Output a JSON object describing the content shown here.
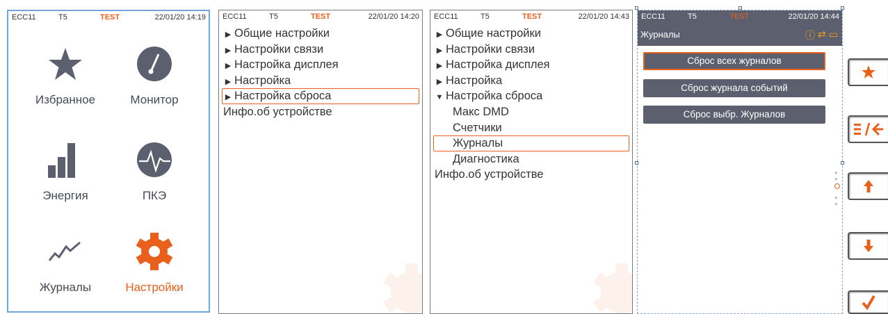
{
  "status": {
    "device": "ECC11",
    "tariff": "T5",
    "mode": "TEST"
  },
  "screen1": {
    "time": "22/01/20 14:19",
    "tiles": [
      {
        "label": "Избранное",
        "icon": "star-icon"
      },
      {
        "label": "Монитор",
        "icon": "gauge-icon"
      },
      {
        "label": "Энергия",
        "icon": "bar-chart-icon"
      },
      {
        "label": "ПКЭ",
        "icon": "waveform-icon"
      },
      {
        "label": "Журналы",
        "icon": "trend-line-icon"
      },
      {
        "label": "Настройки",
        "icon": "settings-gear-icon",
        "active": true
      }
    ]
  },
  "screen2": {
    "time": "22/01/20 14:20",
    "items": [
      "Общие настройки",
      "Настройки связи",
      "Настройка дисплея",
      "Настройка",
      "Настройка сброса",
      "Инфо.об устройстве"
    ]
  },
  "screen3": {
    "time": "22/01/20 14:43",
    "items": [
      "Общие настройки",
      "Настройки связи",
      "Настройка дисплея",
      "Настройка",
      "Настройка сброса"
    ],
    "subitems": [
      "Макс DMD",
      "Счетчики",
      "Журналы",
      "Диагностика"
    ],
    "info": "Инфо.об устройстве"
  },
  "screen4": {
    "time": "22/01/20 14:44",
    "title": "Журналы",
    "buttons": [
      "Сброс всех журналов",
      "Сброс журнала событий",
      "Сброс выбр. Журналов"
    ]
  },
  "keys": [
    "favorite-star-key",
    "menu-back-key",
    "up-arrow-key",
    "down-arrow-key",
    "confirm-check-key"
  ],
  "colors": {
    "accent": "#e8601c",
    "dark": "#5b5f6e",
    "frame": "#6ea6dd"
  }
}
